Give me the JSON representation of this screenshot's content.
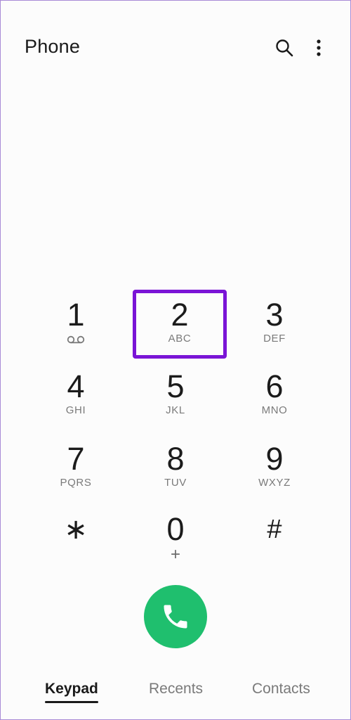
{
  "header": {
    "title": "Phone",
    "search_icon": "search-icon",
    "more_icon": "more-vert-icon"
  },
  "keypad": {
    "keys": [
      {
        "digit": "1",
        "letters": "",
        "icon": "voicemail-icon"
      },
      {
        "digit": "2",
        "letters": "ABC"
      },
      {
        "digit": "3",
        "letters": "DEF"
      },
      {
        "digit": "4",
        "letters": "GHI"
      },
      {
        "digit": "5",
        "letters": "JKL"
      },
      {
        "digit": "6",
        "letters": "MNO"
      },
      {
        "digit": "7",
        "letters": "PQRS"
      },
      {
        "digit": "8",
        "letters": "TUV"
      },
      {
        "digit": "9",
        "letters": "WXYZ"
      },
      {
        "digit": "∗",
        "letters": ""
      },
      {
        "digit": "0",
        "letters": "+"
      },
      {
        "digit": "#",
        "letters": ""
      }
    ],
    "highlight_color": "#7a14d6"
  },
  "call": {
    "icon": "phone-icon",
    "color": "#1fbf6e"
  },
  "tabs": [
    {
      "label": "Keypad",
      "active": true
    },
    {
      "label": "Recents",
      "active": false
    },
    {
      "label": "Contacts",
      "active": false
    }
  ]
}
